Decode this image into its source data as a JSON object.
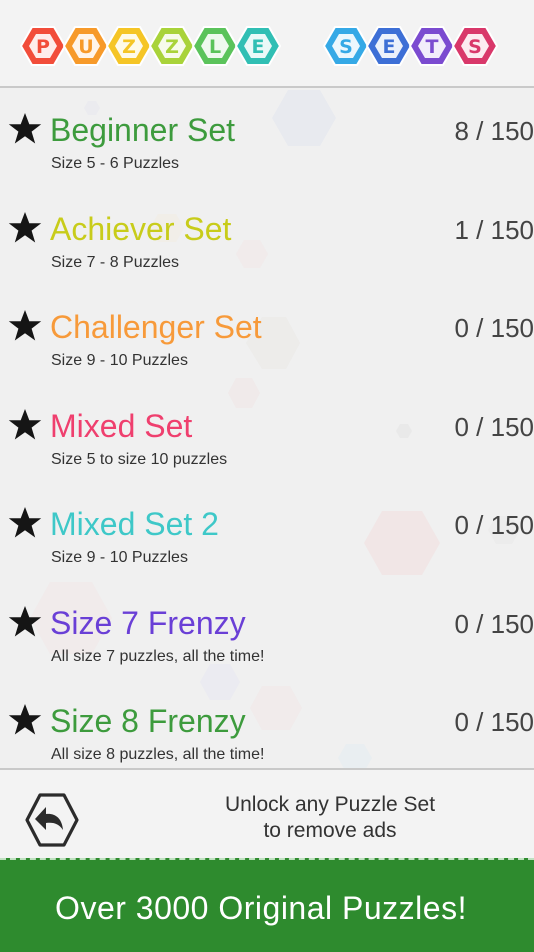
{
  "logo": {
    "letters": [
      "P",
      "U",
      "Z",
      "Z",
      "L",
      "E",
      "S",
      "E",
      "T",
      "S"
    ],
    "colors": [
      "#f24d3a",
      "#f79a2a",
      "#f5c526",
      "#a9d33a",
      "#5bc35b",
      "#31bfb4",
      "#35a9e6",
      "#3d6fd6",
      "#7b4bd0",
      "#d9386a"
    ]
  },
  "sets": [
    {
      "name": "Beginner Set",
      "desc": "Size 5 - 6 Puzzles",
      "progress": "8 / 150",
      "color": "#3d9b3d"
    },
    {
      "name": "Achiever Set",
      "desc": "Size 7 - 8 Puzzles",
      "progress": "1 / 150",
      "color": "#c8cc1a"
    },
    {
      "name": "Challenger Set",
      "desc": "Size 9 - 10 Puzzles",
      "progress": "0 / 150",
      "color": "#f79a3a"
    },
    {
      "name": "Mixed Set",
      "desc": "Size 5 to size 10 puzzles",
      "progress": "0 / 150",
      "color": "#ef3f6e"
    },
    {
      "name": "Mixed Set 2",
      "desc": "Size 9 - 10 Puzzles",
      "progress": "0 / 150",
      "color": "#3ec8c8"
    },
    {
      "name": "Size 7 Frenzy",
      "desc": "All size 7 puzzles, all the time!",
      "progress": "0 / 150",
      "color": "#6a3fd6"
    },
    {
      "name": "Size 8 Frenzy",
      "desc": "All size 8 puzzles, all the time!",
      "progress": "0 / 150",
      "color": "#3d9b3d"
    }
  ],
  "unlock": {
    "line1": "Unlock any Puzzle Set",
    "line2": "to remove ads"
  },
  "promo": {
    "text": "Over 3000 Original Puzzles!",
    "color": "#2e8b2e"
  },
  "icons": {
    "star": "star-icon",
    "back": "back-arrow-icon"
  }
}
